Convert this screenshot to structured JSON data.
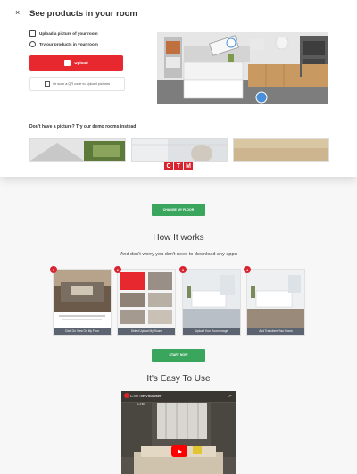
{
  "modal": {
    "title": "See products in your room",
    "close_icon": "close-icon",
    "options": [
      {
        "icon": "camera-icon",
        "label": "Upload a picture of your room"
      },
      {
        "icon": "cube-icon",
        "label": "Try our products in your room"
      }
    ],
    "upload_button": "Upload",
    "qr_text": "Or scan a QR code to Upload pictures",
    "demo_label": "Don't have a picture? Try our demo rooms instead",
    "logo_letters": [
      "C",
      "T",
      "M"
    ]
  },
  "page": {
    "cta_top": "CHANGE MY FLOOR",
    "how_title": "How It works",
    "how_subtitle": "And don't worry you don't need to download any apps",
    "steps": [
      {
        "num": "1",
        "caption": "Click On View On My Floor"
      },
      {
        "num": "2",
        "caption": "Select Upload My Room"
      },
      {
        "num": "3",
        "caption": "Upload Your Room Image"
      },
      {
        "num": "4",
        "caption": "And Transform Your Room"
      }
    ],
    "cta_bottom": "START NOW",
    "easy_title": "It's Easy To Use",
    "video_title": "CTM Tile Visualiser",
    "video_channel": "CTM"
  },
  "colors": {
    "brand_red": "#d9232e",
    "button_red": "#e8282f",
    "green": "#3aa55d",
    "caption_gray": "#5b6470"
  }
}
